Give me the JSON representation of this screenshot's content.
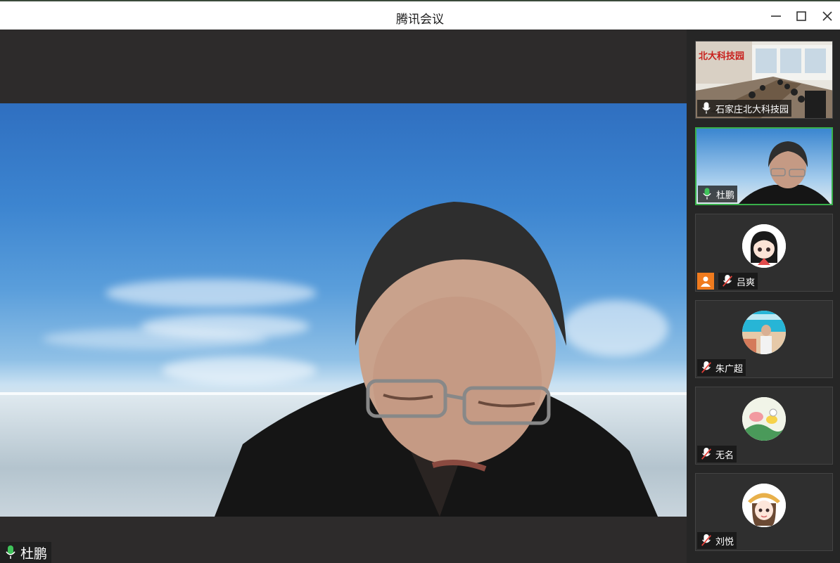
{
  "window": {
    "title": "腾讯会议",
    "controls": [
      "minimize-icon",
      "maximize-icon",
      "close-icon"
    ]
  },
  "main_video": {
    "speaker_name": "杜鹏",
    "mic_state": "active"
  },
  "participants": [
    {
      "name": "石家庄北大科技园",
      "mic": "on",
      "video": "on",
      "sign_text": "北大科技园"
    },
    {
      "name": "杜鹏",
      "mic": "active",
      "video": "on",
      "selected": true
    },
    {
      "name": "吕爽",
      "mic": "muted",
      "video": "off",
      "camera_off_badge": true
    },
    {
      "name": "朱广超",
      "mic": "muted",
      "video": "off"
    },
    {
      "name": "无名",
      "mic": "muted",
      "video": "off"
    },
    {
      "name": "刘悦",
      "mic": "muted",
      "video": "off"
    }
  ],
  "colors": {
    "active_border": "#38b04a",
    "mic_active": "#3fc35a",
    "muted_red": "#e5413a",
    "camera_off_badge": "#f07b1e"
  }
}
